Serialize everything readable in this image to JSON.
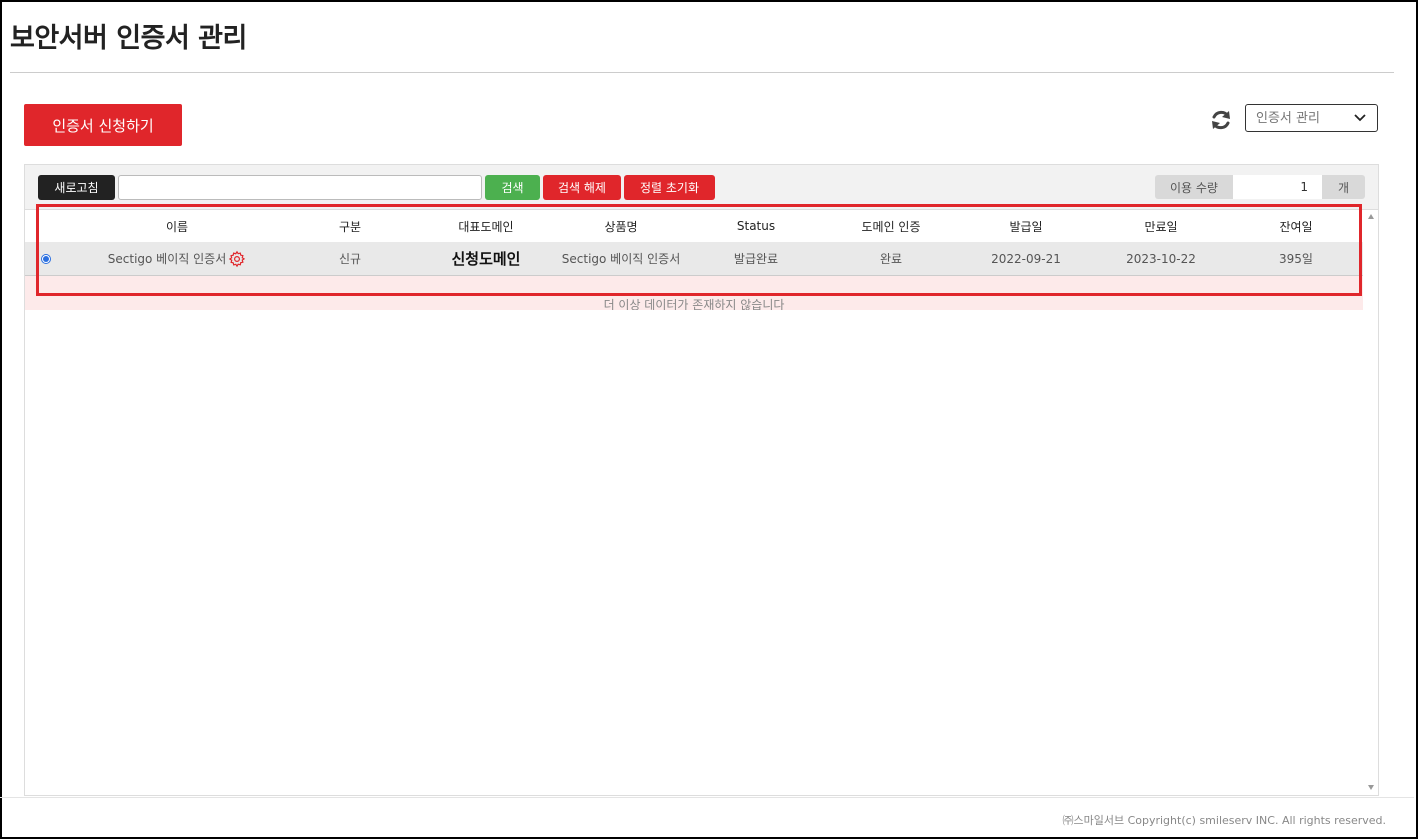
{
  "page": {
    "title": "보안서버 인증서 관리"
  },
  "actions": {
    "apply_label": "인증서 신청하기"
  },
  "top_controls": {
    "refresh_icon": "refresh-icon",
    "select_value": "인증서 관리"
  },
  "toolbar": {
    "refresh_label": "새로고침",
    "search_value": "",
    "search_label": "검색",
    "clear_search_label": "검색 해제",
    "reset_sort_label": "정렬 초기화",
    "usage_label": "이용 수량",
    "usage_value": "1",
    "usage_unit": "개"
  },
  "grid": {
    "headers": [
      "이름",
      "구분",
      "대표도메인",
      "상품명",
      "Status",
      "도메인 인증",
      "발급일",
      "만료일",
      "잔여일"
    ],
    "rows": [
      {
        "name": "Sectigo 베이직 인증서",
        "type": "신규",
        "domain": "신청도메인",
        "product": "Sectigo 베이직 인증서",
        "status": "발급완료",
        "domain_auth": "완료",
        "issued": "2022-09-21",
        "expires": "2023-10-22",
        "remaining": "395일"
      }
    ],
    "empty_message": "더 이상 데이터가 존재하지 않습니다"
  },
  "footer": {
    "copyright": "㈜스마일서브 Copyright(c) smileserv INC. All rights reserved."
  },
  "colors": {
    "accent_red": "#e0262b",
    "search_green": "#4cb04f",
    "dark_button": "#222222",
    "selected_row": "#e9e9e9",
    "empty_row": "#fdeaea"
  }
}
